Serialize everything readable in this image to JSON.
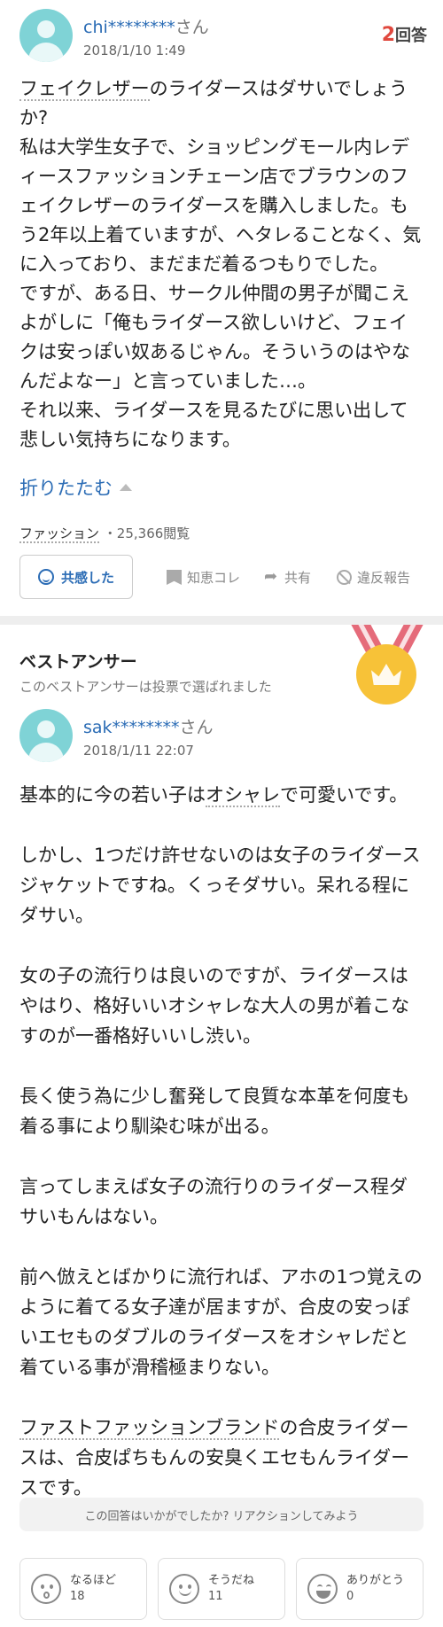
{
  "question": {
    "user": {
      "name": "chi********",
      "honorific": "さん",
      "date": "2018/1/10 1:49"
    },
    "answers": {
      "count": "2",
      "label": "回答"
    },
    "title_part1": "フェイクレザー",
    "title_part2": "のライダースはダサいでしょうか?",
    "body": "私は大学生女子で、ショッピングモール内レディースファッションチェーン店でブラウンのフェイクレザーのライダースを購入しました。もう2年以上着ていますが、ヘタレることなく、気に入っており、まだまだ着るつもりでした。\nですが、ある日、サークル仲間の男子が聞こえよがしに「俺もライダース欲しいけど、フェイクは安っぽい奴あるじゃん。そういうのはやなんだよなー」と言っていました…。\nそれ以来、ライダースを見るたびに思い出して悲しい気持ちになります。",
    "collapse_label": "折りたたむ",
    "category": "ファッション",
    "views": "・25,366閲覧",
    "actions": {
      "empathy": "共感した",
      "chiebukuro": "知恵コレ",
      "share": "共有",
      "report": "違反報告"
    }
  },
  "best_answer": {
    "title": "ベストアンサー",
    "subtitle": "このベストアンサーは投票で選ばれました",
    "user": {
      "name": "sak********",
      "honorific": "さん",
      "date": "2018/1/11 22:07"
    },
    "p1_a": "基本的に今の若い子は",
    "p1_link": "オシャレ",
    "p1_b": "で可愛いです。",
    "p2": "しかし、1つだけ許せないのは女子のライダースジャケットですね。くっそダサい。呆れる程にダサい。",
    "p3": "女の子の流行りは良いのですが、ライダースはやはり、格好いいオシャレな大人の男が着こなすのが一番格好いいし渋い。",
    "p4": "長く使う為に少し奮発して良質な本革を何度も着る事により馴染む味が出る。",
    "p5": "言ってしまえば女子の流行りのライダース程ダサいもんはない。",
    "p6": "前へ倣えとばかりに流行れば、アホの1つ覚えのように着てる女子達が居ますが、合皮の安っぽいエセものダブルのライダースをオシャレだと着ている事が滑稽極まりない。",
    "p7_link": "ファストファッションブランド",
    "p7_b": "の合皮ライダースは、合皮ぱちもんの安臭くエセもんライダースです。"
  },
  "reaction": {
    "prompt": "この回答はいかがでしたか? リアクションしてみよう",
    "items": [
      {
        "label": "なるほど",
        "count": "18",
        "icon": "surprised-face-icon"
      },
      {
        "label": "そうだね",
        "count": "11",
        "icon": "smile-face-icon"
      },
      {
        "label": "ありがとう",
        "count": "0",
        "icon": "grin-face-icon"
      }
    ]
  },
  "colors": {
    "link": "#2b6cb5",
    "accent_red": "#e0483e",
    "medal_gold": "#f7c238",
    "ribbon": "#e56b7a"
  }
}
